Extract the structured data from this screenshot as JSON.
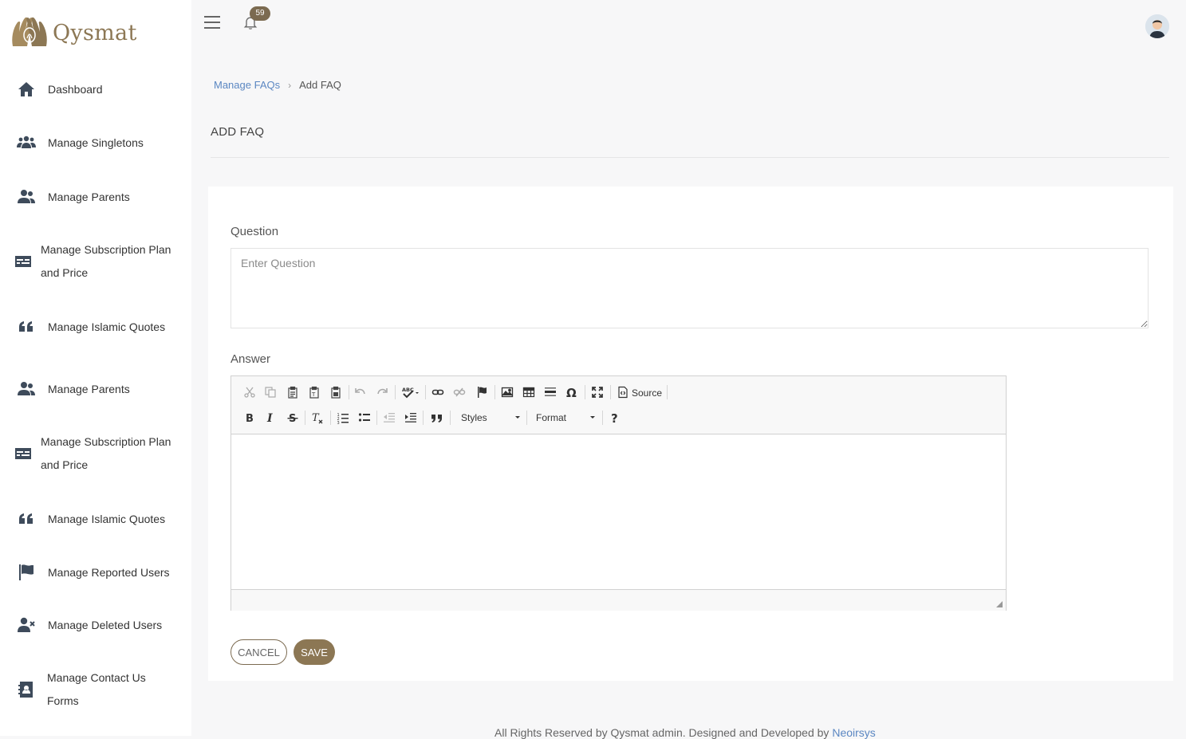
{
  "brand": {
    "name": "Qysmat",
    "color": "#8c7754"
  },
  "sidebar": {
    "items": [
      {
        "label": "Dashboard",
        "icon": "home-icon"
      },
      {
        "label": "Manage Singletons",
        "icon": "users-icon"
      },
      {
        "label": "Manage Parents",
        "icon": "user-group-icon"
      },
      {
        "label_line1": "Manage Subscription Plan",
        "label_line2": "and Price",
        "icon": "id-card-icon"
      },
      {
        "label": "Manage Islamic Quotes",
        "icon": "quote-icon"
      },
      {
        "label": "Manage Parents",
        "icon": "user-group-icon"
      },
      {
        "label_line1": "Manage Subscription Plan",
        "label_line2": "and Price",
        "icon": "id-card-icon"
      },
      {
        "label": "Manage Islamic Quotes",
        "icon": "quote-icon"
      },
      {
        "label": "Manage Reported Users",
        "icon": "flag-icon"
      },
      {
        "label": "Manage Deleted Users",
        "icon": "user-remove-icon"
      },
      {
        "label_line1": "Manage Contact Us",
        "label_line2": "Forms",
        "icon": "contact-book-icon"
      }
    ]
  },
  "topbar": {
    "notification_count": "59"
  },
  "breadcrumb": {
    "parent": "Manage FAQs",
    "current": "Add FAQ"
  },
  "page": {
    "title": "ADD FAQ"
  },
  "form": {
    "question_label": "Question",
    "question_placeholder": "Enter Question",
    "question_value": "",
    "answer_label": "Answer",
    "editor": {
      "source_label": "Source",
      "styles_label": "Styles",
      "format_label": "Format",
      "content": ""
    },
    "cancel_label": "CANCEL",
    "save_label": "SAVE"
  },
  "footer": {
    "text": "All Rights Reserved by Qysmat admin. Designed and Developed by ",
    "link": "Neoirsys"
  }
}
